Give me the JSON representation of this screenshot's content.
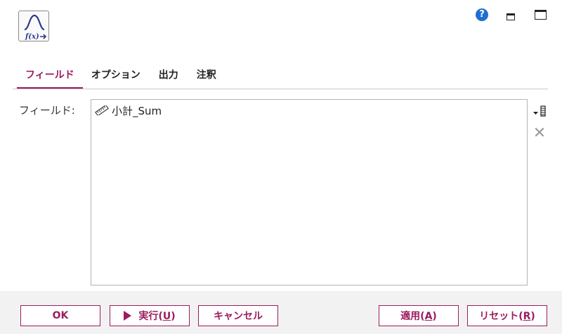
{
  "header": {
    "app_icon": "distribution-function-icon",
    "app_icon_text": "f(x)",
    "help_label": "?",
    "icons": [
      "help-icon",
      "minimize-icon",
      "maximize-icon"
    ]
  },
  "tabs": [
    {
      "label": "フィールド",
      "active": true
    },
    {
      "label": "オプション",
      "active": false
    },
    {
      "label": "出力",
      "active": false
    },
    {
      "label": "注釈",
      "active": false
    }
  ],
  "fields": {
    "label": "フィールド:",
    "items": [
      {
        "label": "小計_Sum",
        "icon": "continuous-ruler-icon"
      }
    ]
  },
  "side_tools": [
    "pick-field-icon",
    "delete-icon"
  ],
  "footer": {
    "ok": "OK",
    "run_prefix": "実行(",
    "run_key": "U",
    "run_suffix": ")",
    "cancel": "キャンセル",
    "apply_prefix": "適用(",
    "apply_key": "A",
    "apply_suffix": ")",
    "reset_prefix": "リセット(",
    "reset_key": "R",
    "reset_suffix": ")"
  },
  "colors": {
    "accent": "#9b1c5f",
    "help": "#1f6fd0",
    "footer_bg": "#f2f2f2",
    "border": "#b4b4b4"
  }
}
